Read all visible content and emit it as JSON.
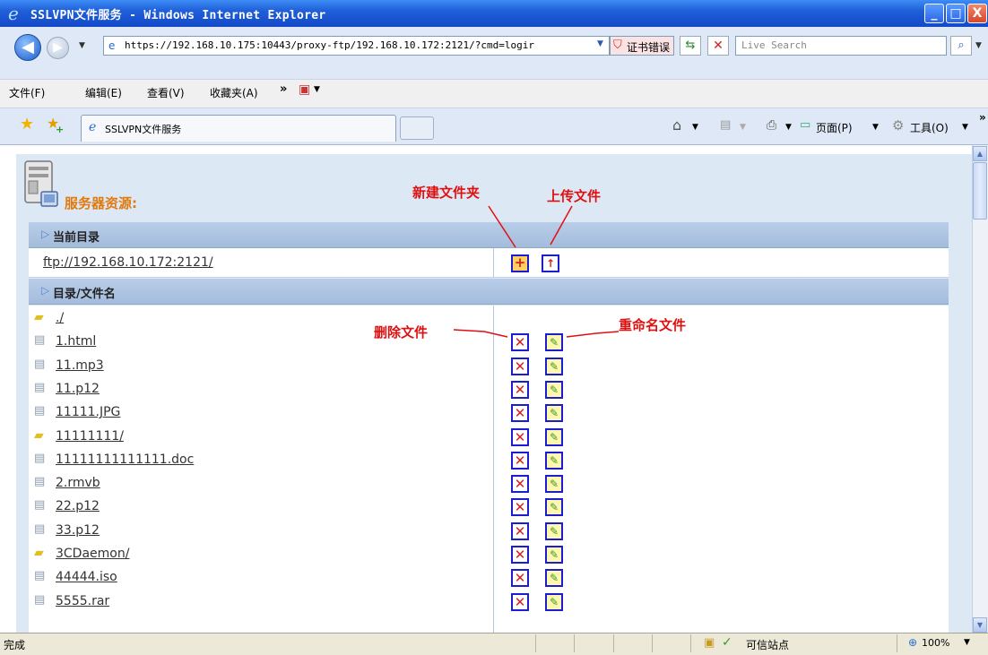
{
  "window": {
    "title": "SSLVPN文件服务 - Windows Internet Explorer",
    "minimize": "_",
    "maximize": "□",
    "close": "X"
  },
  "address": {
    "url": "https://192.168.10.175:10443/proxy-ftp/192.168.10.172:2121/?cmd=logir",
    "cert_error": "证书错误",
    "search_placeholder": "Live Search"
  },
  "menu": {
    "items": [
      "文件(F)",
      "编辑(E)",
      "查看(V)",
      "收藏夹(A)"
    ],
    "more": "»"
  },
  "tabs": {
    "active_label": "SSLVPN文件服务"
  },
  "toolbar": {
    "page_label": "页面(P)",
    "tools_label": "工具(O)"
  },
  "content": {
    "server_title": "服务器资源:",
    "current_dir_header": "当前目录",
    "current_path": "ftp://192.168.10.172:2121/",
    "list_header": "目录/文件名",
    "files": [
      {
        "name": "./",
        "type": "folder"
      },
      {
        "name": "1.html",
        "type": "file"
      },
      {
        "name": "11.mp3",
        "type": "file"
      },
      {
        "name": "11.p12",
        "type": "file"
      },
      {
        "name": "11111.JPG",
        "type": "file"
      },
      {
        "name": "11111111/",
        "type": "folder"
      },
      {
        "name": "11111111111111.doc",
        "type": "file"
      },
      {
        "name": "2.rmvb",
        "type": "file"
      },
      {
        "name": "22.p12",
        "type": "file"
      },
      {
        "name": "33.p12",
        "type": "file"
      },
      {
        "name": "3CDaemon/",
        "type": "folder"
      },
      {
        "name": "44444.iso",
        "type": "file"
      },
      {
        "name": "5555.rar",
        "type": "file"
      }
    ]
  },
  "annotations": {
    "new_folder": "新建文件夹",
    "upload_file": "上传文件",
    "delete_file": "删除文件",
    "rename_file": "重命名文件"
  },
  "status": {
    "text": "完成",
    "trusted": "可信站点",
    "zoom": "100%"
  },
  "colors": {
    "annotation": "#e01010",
    "header_bg": "#a4bcdc",
    "server_title": "#e07a10",
    "action_border": "#1d1dd0"
  }
}
